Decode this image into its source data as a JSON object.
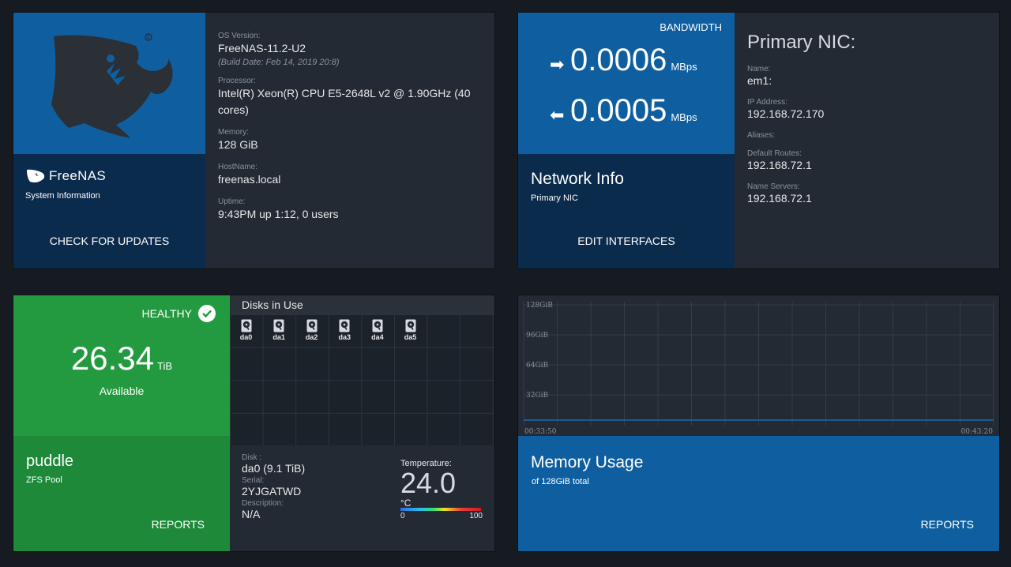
{
  "system": {
    "brand": "FreeNAS",
    "subtitle": "System Information",
    "check_updates": "CHECK FOR UPDATES",
    "os_version_label": "OS Version:",
    "os_version": "FreeNAS-11.2-U2",
    "build_date": "(Build Date: Feb 14, 2019 20:8)",
    "processor_label": "Processor:",
    "processor": "Intel(R) Xeon(R) CPU E5-2648L v2 @ 1.90GHz (40 cores)",
    "memory_label": "Memory:",
    "memory": "128 GiB",
    "hostname_label": "HostName:",
    "hostname": "freenas.local",
    "uptime_label": "Uptime:",
    "uptime": "9:43PM up 1:12, 0 users"
  },
  "network": {
    "bandwidth_label": "BANDWIDTH",
    "in_value": "0.0006",
    "out_value": "0.0005",
    "unit": "MBps",
    "title": "Network Info",
    "subtitle": "Primary NIC",
    "edit_interfaces": "EDIT INTERFACES",
    "nic_heading": "Primary NIC:",
    "name_label": "Name:",
    "name": "em1:",
    "ip_label": "IP Address:",
    "ip": "192.168.72.170",
    "aliases_label": "Aliases:",
    "routes_label": "Default Routes:",
    "routes": "192.168.72.1",
    "ns_label": "Name Servers:",
    "ns": "192.168.72.1"
  },
  "pool": {
    "status": "HEALTHY",
    "available": "26.34",
    "available_unit": "TiB",
    "available_label": "Available",
    "name": "puddle",
    "type": "ZFS Pool",
    "reports": "REPORTS",
    "disks_title": "Disks in Use",
    "disks": [
      "da0",
      "da1",
      "da2",
      "da3",
      "da4",
      "da5"
    ],
    "disk_label": "Disk :",
    "disk_value": "da0 (9.1 TiB)",
    "serial_label": "Serial:",
    "serial_value": "2YJGATWD",
    "description_label": "Description:",
    "description_value": "N/A",
    "temperature_label": "Temperature:",
    "temperature_value": "24.0",
    "temperature_unit": "°C",
    "scale_min": "0",
    "scale_max": "100"
  },
  "memory": {
    "title": "Memory Usage",
    "subtitle": "of 128GiB total",
    "reports": "REPORTS"
  },
  "chart_data": {
    "type": "line",
    "x": [
      "00:33:50",
      "00:43:20"
    ],
    "series": [
      {
        "values": [
          0,
          0
        ]
      }
    ],
    "ylim": [
      0,
      128
    ],
    "yticks": [
      "32GiB",
      "64GiB",
      "96GiB",
      "128GiB"
    ],
    "grid": true,
    "colors": {
      "line": "#1c6bb0",
      "grid": "#343c46"
    }
  },
  "colors": {
    "primary": "#0f5fa0",
    "primary_dark": "#0b2b4c",
    "healthy": "#249a40",
    "card": "#232a33",
    "background": "#161b22"
  }
}
